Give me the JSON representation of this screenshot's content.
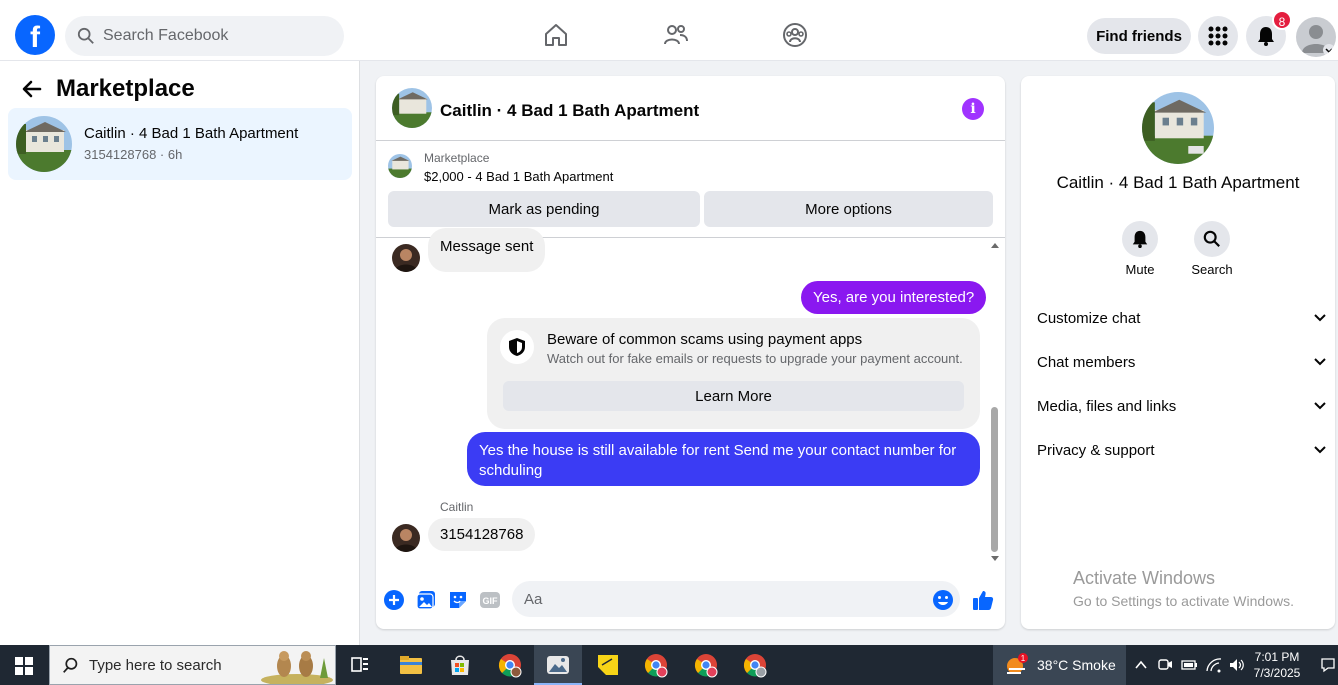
{
  "topbar": {
    "logo_letter": "f",
    "search_placeholder": "Search Facebook",
    "find_friends_label": "Find friends",
    "notification_count": "8"
  },
  "sidebar": {
    "title": "Marketplace",
    "conversation": {
      "name": "Caitlin · 4 Bad 1 Bath Apartment",
      "subtitle": "3154128768 · 6h"
    }
  },
  "chat": {
    "title": "Caitlin · 4 Bad 1 Bath Apartment",
    "marketplace_label": "Marketplace",
    "listing": "$2,000 - 4 Bad 1 Bath Apartment",
    "mark_pending_label": "Mark as pending",
    "more_options_label": "More options",
    "messages": {
      "m1": "Message sent",
      "m2": "Yes, are you interested?",
      "m3": "Yes the house is still available for rent Send me your contact number for schduling",
      "m4_sender": "Caitlin",
      "m4": "3154128768"
    },
    "warning": {
      "title": "Beware of common scams using payment apps",
      "text": "Watch out for fake emails or requests to upgrade your payment account.",
      "button": "Learn More"
    },
    "composer_placeholder": "Aa",
    "gif_label": "GIF"
  },
  "right_panel": {
    "name": "Caitlin · 4 Bad 1 Bath Apartment",
    "mute_label": "Mute",
    "search_label": "Search",
    "rows": [
      "Customize chat",
      "Chat members",
      "Media, files and links",
      "Privacy & support"
    ],
    "watermark_title": "Activate Windows",
    "watermark_text": "Go to Settings to activate Windows."
  },
  "taskbar": {
    "search_placeholder": "Type here to search",
    "weather_badge": "1",
    "weather": "38°C  Smoke",
    "time": "7:01 PM",
    "date": "7/3/2025"
  },
  "colors": {
    "facebook_blue": "#0866ff",
    "sent_purple": "#8a18f0",
    "sent_blue": "#3b3cf4",
    "info_purple": "#a033ff",
    "taskbar": "#1f2833"
  },
  "icons": [
    "search-icon",
    "home-icon",
    "friends-icon",
    "groups-icon",
    "menu-grid-icon",
    "bell-icon",
    "back-arrow-icon",
    "info-icon",
    "shield-icon",
    "plus-icon",
    "image-icon",
    "sticker-icon",
    "gif-icon",
    "emoji-icon",
    "thumbs-up-icon",
    "chevron-down-icon",
    "windows-icon"
  ]
}
